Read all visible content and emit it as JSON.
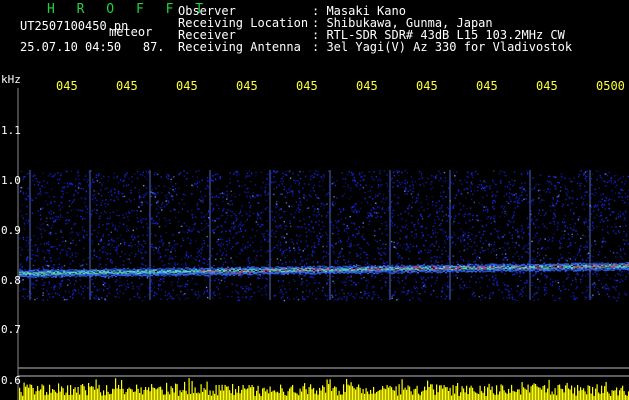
{
  "header": {
    "app_title": "H R O F F T",
    "file_name": "UT2507100450.pn",
    "file_suffix": "meteor",
    "timestamp": "25.07.10 04:50",
    "timestamp_value": "87."
  },
  "info": [
    {
      "key": "Observer",
      "value": ": Masaki Kano"
    },
    {
      "key": "Receiving Location",
      "value": ": Shibukawa, Gunma, Japan"
    },
    {
      "key": "Receiver",
      "value": ": RTL-SDR SDR# 43dB L15 103.2MHz CW"
    },
    {
      "key": "Receiving Antenna",
      "value": ": 3el Yagi(V) Az 330 for Vladivostok"
    }
  ],
  "axis": {
    "unit": "kHz",
    "y_ticks": [
      "1.1",
      "1.0",
      "0.9",
      "0.8",
      "0.7",
      "0.6"
    ],
    "time_ticks": [
      "045",
      "045",
      "045",
      "045",
      "045",
      "045",
      "045",
      "045",
      "045",
      "0500"
    ]
  },
  "colors": {
    "background": "#000000",
    "title": "#22d23a",
    "time_labels": "#ffff33",
    "noise": "#1a2aff",
    "trace": "#ff3355",
    "signal_bars": "#ffff00"
  }
}
